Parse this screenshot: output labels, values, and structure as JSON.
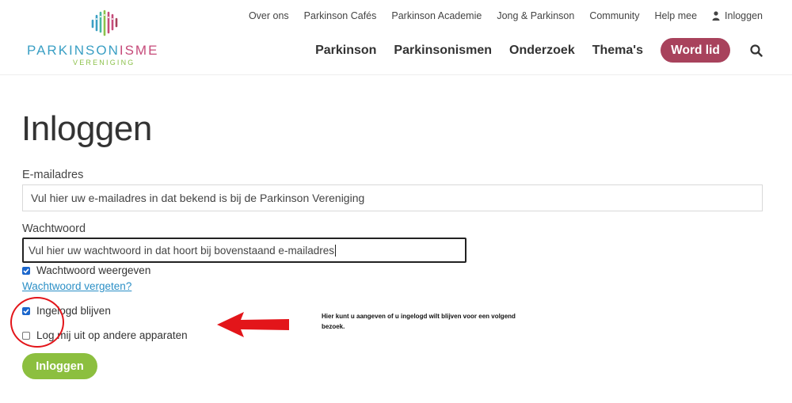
{
  "logo": {
    "text_main": "PARKINSON",
    "text_accent": "ISME",
    "subtext": "VERENIGING",
    "colors": {
      "blue": "#3a9fc4",
      "pink": "#c64b7a",
      "green": "#8cc14b"
    }
  },
  "top_nav": [
    "Over ons",
    "Parkinson Cafés",
    "Parkinson Academie",
    "Jong & Parkinson",
    "Community",
    "Help mee"
  ],
  "login_link": {
    "label": "Inloggen",
    "icon": "user-icon"
  },
  "main_nav": [
    "Parkinson",
    "Parkinsonismen",
    "Onderzoek",
    "Thema's"
  ],
  "word_lid": {
    "label": "Word lid",
    "color": "#a8425c"
  },
  "search_icon": "search-icon",
  "page": {
    "title": "Inloggen",
    "email_label": "E-mailadres",
    "email_value": "Vul hier uw e-mailadres in dat bekend is bij de Parkinson Vereniging",
    "password_label": "Wachtwoord",
    "password_value": "Vul hier uw wachtwoord in dat hoort bij bovenstaand e-mailadres",
    "show_password": {
      "label": "Wachtwoord weergeven",
      "checked": true
    },
    "forgot_link": "Wachtwoord vergeten?",
    "stay_logged_in": {
      "label": "Ingelogd blijven",
      "checked": true
    },
    "logout_others": {
      "label": "Log mij uit op andere apparaten",
      "checked": false
    },
    "submit_label": "Inloggen",
    "submit_color": "#8cbf3f"
  },
  "annotation": {
    "note": "Hier kunt u aangeven of u ingelogd wilt blijven voor een volgend bezoek.",
    "color": "#e3151a"
  }
}
